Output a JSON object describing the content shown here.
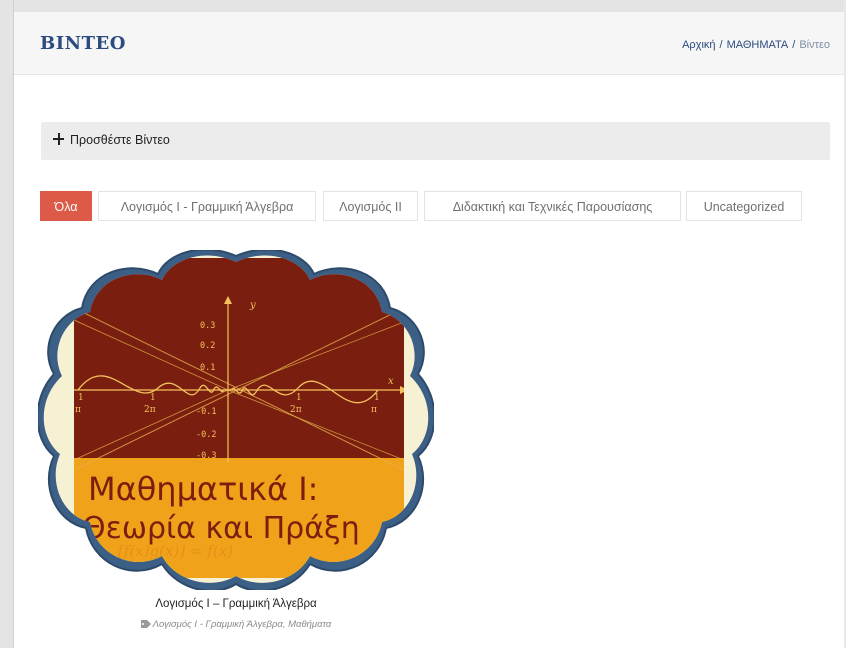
{
  "header": {
    "title": "BINTEO",
    "breadcrumb": [
      {
        "label": "Αρχική"
      },
      {
        "label": "ΜΑΘΗΜΑΤΑ"
      },
      {
        "label": "Βίντεο"
      }
    ],
    "separator": "/"
  },
  "add_bar": {
    "icon": "plus-icon",
    "label": "Προσθέστε Βίντεο"
  },
  "filters": [
    {
      "label": "Όλα",
      "active": true
    },
    {
      "label": "Λογισμός Ι - Γραμμική Άλγεβρα",
      "active": false
    },
    {
      "label": "Λογισμός ΙΙ",
      "active": false
    },
    {
      "label": "Διδακτική και Τεχνικές Παρουσίασης",
      "active": false
    },
    {
      "label": "Uncategorized",
      "active": false
    }
  ],
  "video_item": {
    "thumbnail": {
      "cover_title_line1": "Μαθηματικά Ι:",
      "cover_title_line2": "Θεωρία και Πράξη",
      "axis_labels": {
        "y_axis": "y",
        "x_axis": "x",
        "y_ticks": [
          "0.3",
          "0.2",
          "0.1",
          "-0.1",
          "-0.2",
          "-0.3"
        ],
        "x_tick_top": [
          "1",
          "1",
          "1",
          "1"
        ],
        "x_tick_bottom": [
          "π",
          "2π",
          "2π",
          "π"
        ]
      },
      "formula_fragment": "[f(x)g(x)] = f(x)"
    },
    "caption": "Λογισμός Ι – Γραμμική Άλγεβρα",
    "tags": "Λογισμός Ι - Γραμμική Άλγεβρα, Μαθήματα",
    "tag_icon": "tag-icon"
  },
  "colors": {
    "title": "#2b4c7e",
    "active_filter": "#dd5a48",
    "cover_dark": "#7a1f10",
    "cover_orange": "#f0a21a",
    "frame_blue": "#3c5f86",
    "frame_cream": "#f7f1d3"
  }
}
